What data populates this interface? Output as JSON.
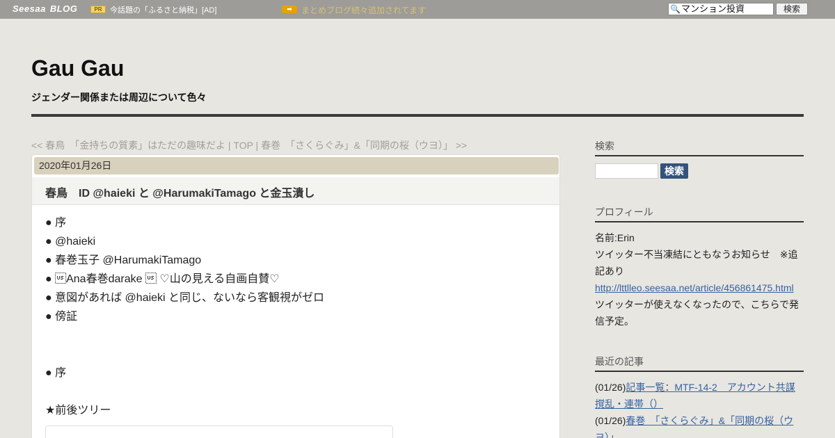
{
  "topbar": {
    "brand": "Seesaa",
    "brand_blog": "BLOG",
    "pr_badge": "PR",
    "pr_text": "今話題の「ふるさと納税」[AD]",
    "notice_text": "まとめブログ続々追加されてます",
    "search_value": "マンション投資",
    "search_button": "検索"
  },
  "header": {
    "title": "Gau Gau",
    "description": "ジェンダー関係または周辺について色々"
  },
  "post_nav": {
    "prev": "<< 春鳥　「金持ちの質素」はただの趣味だよ",
    "sep1": " | ",
    "top": "TOP",
    "sep2": " | ",
    "next": "春巻　「さくらぐみ」&「同期の桜（ウヨ）」 >>"
  },
  "post": {
    "date": "2020年01月26日",
    "title": "春鳥　ID @haieki と @HarumakiTamago と金玉潰し",
    "toc": [
      "● 序",
      "● @haieki",
      "● 春巻玉子 @HarumakiTamago",
      "● \u001fAna春巻darake \u001f ♡山の見える自画自賛♡",
      "● 意図があれば @haieki と同じ、ないなら客観視がゼロ",
      "● 傍証"
    ],
    "section_jo": "● 序",
    "section_tree": "★前後ツリー"
  },
  "sidebar": {
    "search": {
      "title": "検索",
      "button": "検索"
    },
    "profile": {
      "title": "プロフィール",
      "name": "名前:Erin",
      "text": "ツイッター不当凍結にともなうお知らせ　※追記あり",
      "link": "http://lttlleo.seesaa.net/article/456861475.html",
      "text2": "ツイッターが使えなくなったので、こちらで発信予定。"
    },
    "recent": {
      "title": "最近の記事",
      "items": [
        {
          "date": "(01/26)",
          "label": "記事一覧：MTF-14-2　アカウント共謀撹乱・連帯（）"
        },
        {
          "date": "(01/26)",
          "label": "春巻　「さくらぐみ」&「同期の桜（ウヨ）」"
        }
      ]
    }
  }
}
